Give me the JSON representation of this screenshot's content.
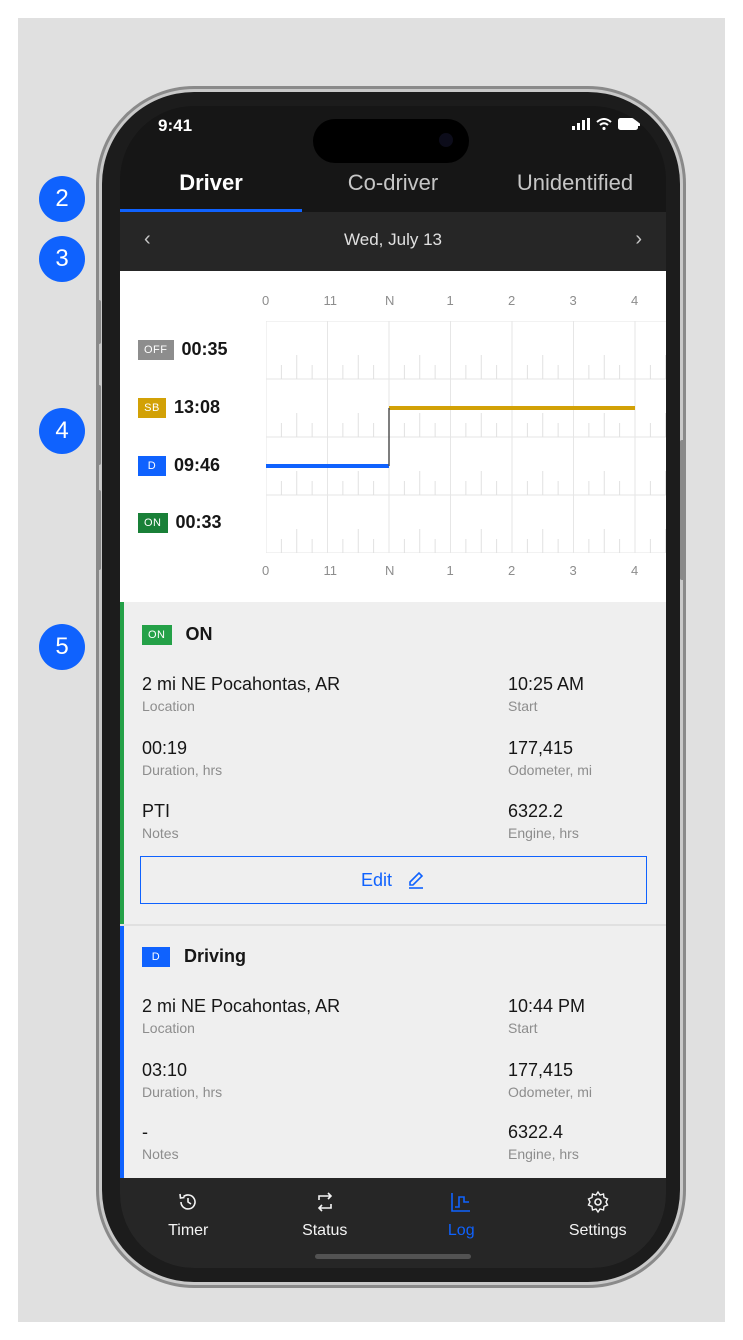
{
  "badges": [
    "2",
    "3",
    "4",
    "5"
  ],
  "status_bar": {
    "time": "9:41"
  },
  "tabs": [
    {
      "label": "Driver",
      "active": true
    },
    {
      "label": "Co-driver",
      "active": false
    },
    {
      "label": "Unidentified",
      "active": false
    }
  ],
  "date_nav": {
    "prev": "‹",
    "date": "Wed, July 13",
    "next": "›"
  },
  "chart": {
    "hour_labels": [
      "0",
      "11",
      "N",
      "1",
      "2",
      "3",
      "4"
    ],
    "legend": [
      {
        "code": "OFF",
        "value": "00:35",
        "color": "#8d8d8d"
      },
      {
        "code": "SB",
        "value": "13:08",
        "color": "#d2a106"
      },
      {
        "code": "D",
        "value": "09:46",
        "color": "#0f62fe"
      },
      {
        "code": "ON",
        "value": "00:33",
        "color": "#198038"
      }
    ]
  },
  "chart_data": {
    "type": "line",
    "x_categories": [
      "0",
      "11",
      "N",
      "1",
      "2",
      "3",
      "4"
    ],
    "rows": [
      "OFF",
      "SB",
      "D",
      "ON"
    ],
    "segments": [
      {
        "status": "D",
        "from_index": 0,
        "to_index": 2
      },
      {
        "status": "SB",
        "from_index": 2,
        "to_index": 6
      }
    ]
  },
  "events": [
    {
      "code": "ON",
      "title": "ON",
      "color": "#24a148",
      "bar_color": "#24a148",
      "location": "2 mi NE Pocahontas, AR",
      "location_label": "Location",
      "start": "10:25 AM",
      "start_label": "Start",
      "duration": "00:19",
      "duration_label": "Duration, hrs",
      "odometer": "177,415",
      "odometer_label": "Odometer, mi",
      "notes": "PTI",
      "notes_label": "Notes",
      "engine": "6322.2",
      "engine_label": "Engine, hrs",
      "edit_label": "Edit"
    },
    {
      "code": "D",
      "title": "Driving",
      "color": "#0f62fe",
      "bar_color": "#0f62fe",
      "location": "2 mi NE Pocahontas, AR",
      "location_label": "Location",
      "start": "10:44 PM",
      "start_label": "Start",
      "duration": "03:10",
      "duration_label": "Duration, hrs",
      "odometer": "177,415",
      "odometer_label": "Odometer, mi",
      "notes": "-",
      "notes_label": "Notes",
      "engine": "6322.4",
      "engine_label": "Engine, hrs"
    }
  ],
  "bottom_nav": [
    {
      "label": "Timer",
      "icon": "history-icon",
      "active": false
    },
    {
      "label": "Status",
      "icon": "swap-icon",
      "active": false
    },
    {
      "label": "Log",
      "icon": "log-chart-icon",
      "active": true
    },
    {
      "label": "Settings",
      "icon": "gear-icon",
      "active": false
    }
  ]
}
